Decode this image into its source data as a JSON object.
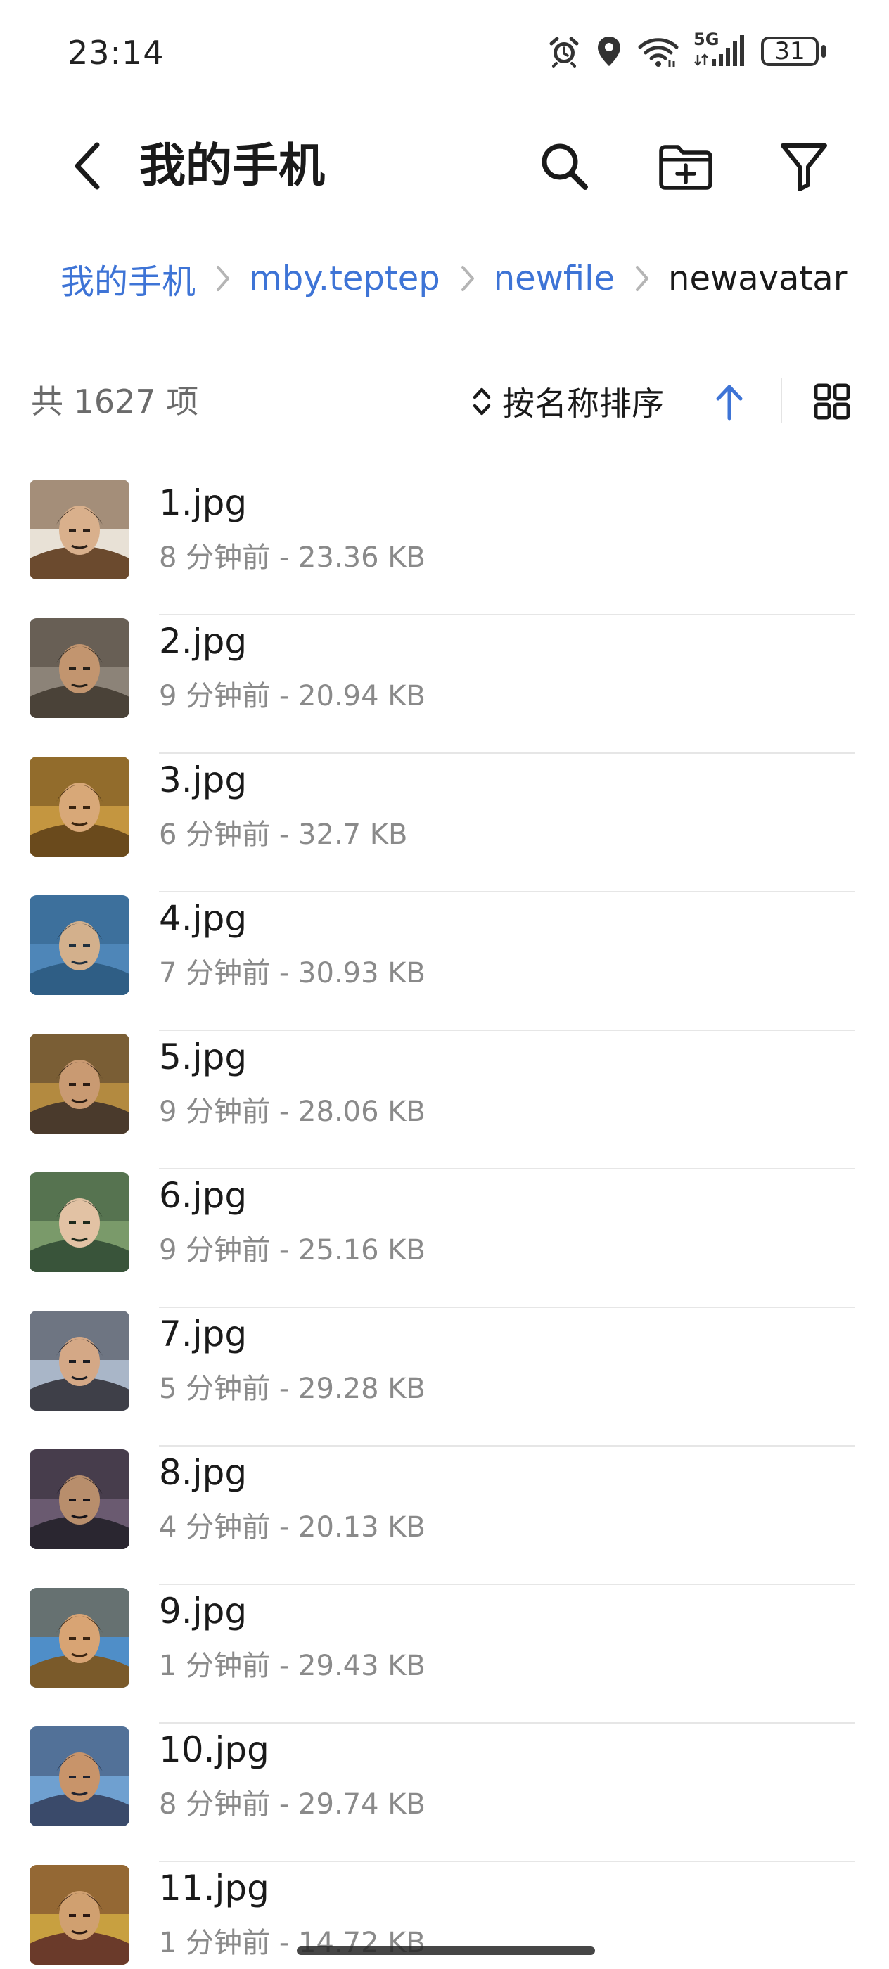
{
  "status_bar": {
    "time": "23:14",
    "network": "5G",
    "battery": "31",
    "icons": [
      "alarm-icon",
      "location-icon",
      "wifi-icon",
      "cellular-signal-icon",
      "battery-icon"
    ]
  },
  "app_bar": {
    "title": "我的手机",
    "icons": [
      "back-arrow-icon",
      "search-icon",
      "new-folder-icon",
      "filter-icon"
    ]
  },
  "breadcrumb": {
    "items": [
      "我的手机",
      "mby.teptep",
      "newfile",
      "newavatar"
    ],
    "separator_icon": "chevron-right-icon"
  },
  "list_header": {
    "count": "共 1627 项",
    "sort_label": "按名称排序",
    "sort_direction": "ascending",
    "icons": [
      "sort-toggle-icon",
      "arrow-up-icon",
      "grid-view-icon"
    ]
  },
  "files": [
    {
      "name": "1.jpg",
      "meta": "8 分钟前 - 23.36 KB"
    },
    {
      "name": "2.jpg",
      "meta": "9 分钟前 - 20.94 KB"
    },
    {
      "name": "3.jpg",
      "meta": "6 分钟前 - 32.7 KB"
    },
    {
      "name": "4.jpg",
      "meta": "7 分钟前 - 30.93 KB"
    },
    {
      "name": "5.jpg",
      "meta": "9 分钟前 - 28.06 KB"
    },
    {
      "name": "6.jpg",
      "meta": "9 分钟前 - 25.16 KB"
    },
    {
      "name": "7.jpg",
      "meta": "5 分钟前 - 29.28 KB"
    },
    {
      "name": "8.jpg",
      "meta": "4 分钟前 - 20.13 KB"
    },
    {
      "name": "9.jpg",
      "meta": "1 分钟前 - 29.43 KB"
    },
    {
      "name": "10.jpg",
      "meta": "8 分钟前 - 29.74 KB"
    },
    {
      "name": "11.jpg",
      "meta": "1 分钟前 - 14.72 KB"
    }
  ],
  "colors": {
    "accent": "#3e74d6",
    "primary_text": "#1a1a1a",
    "secondary_text": "#8a8a8a",
    "divider": "#e6e6e6",
    "background": "#ffffff"
  }
}
